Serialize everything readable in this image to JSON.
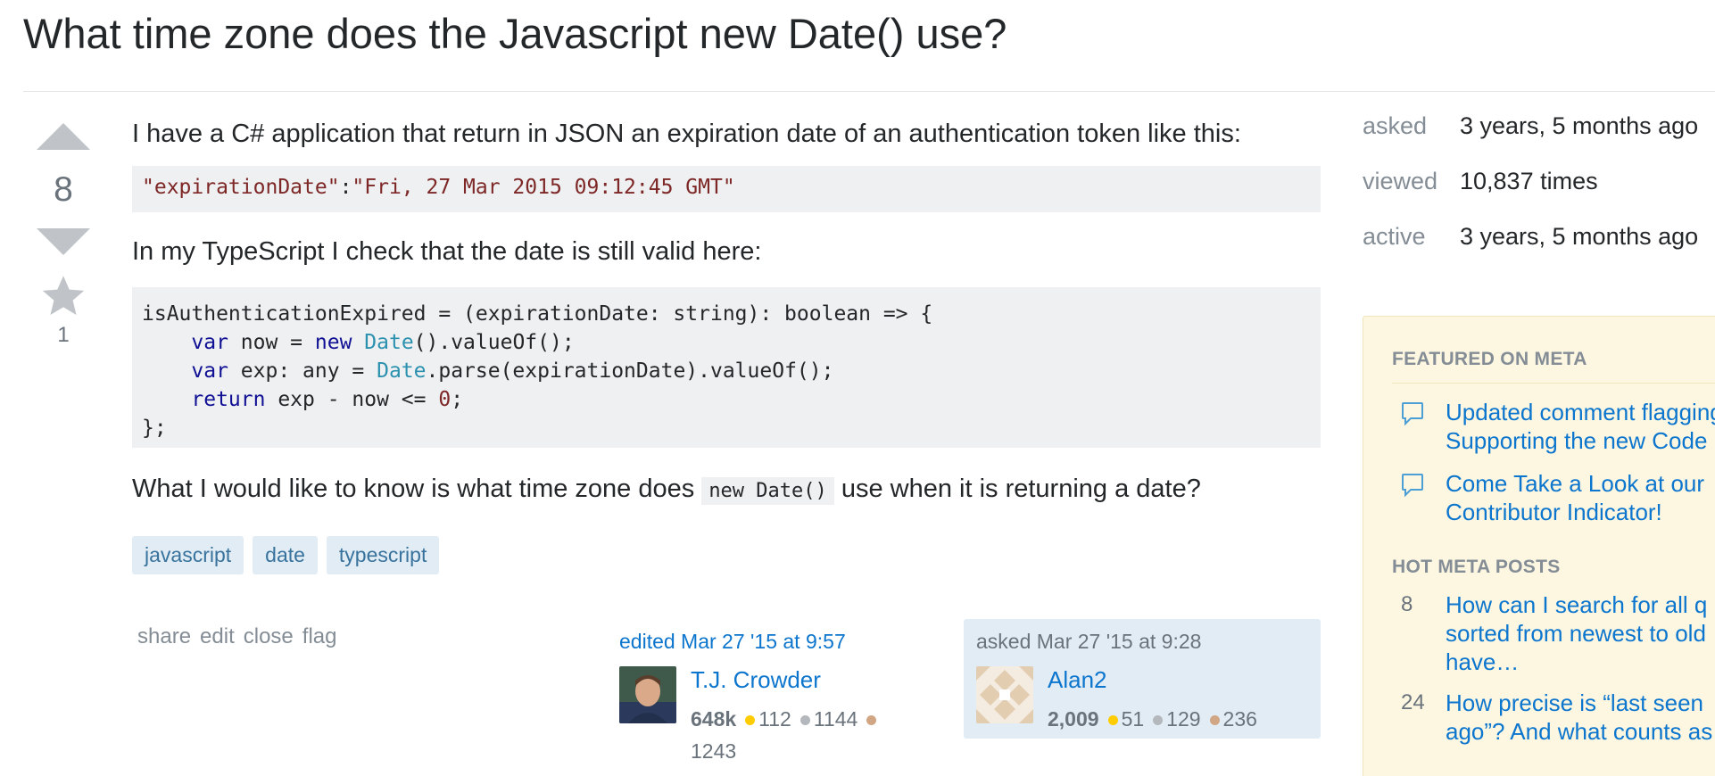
{
  "question": {
    "title": "What time zone does the Javascript new Date() use?",
    "votes": "8",
    "favorites": "1",
    "body": {
      "p1": "I have a C# application that return in JSON an expiration date of an authentication token like this:",
      "code1": {
        "key": "\"expirationDate\"",
        "colon": ":",
        "value": "\"Fri, 27 Mar 2015 09:12:45 GMT\""
      },
      "p2": "In my TypeScript I check that the date is still valid here:",
      "code2": {
        "line1": "isAuthenticationExpired = (expirationDate: string): boolean => {",
        "line2_indent": "    ",
        "var": "var",
        "now_assign": " now = ",
        "new": "new",
        "space": " ",
        "Date": "Date",
        "valueof1": "().valueOf();",
        "exp_decl": " exp: any = ",
        "parse": ".parse(expirationDate).valueOf();",
        "return": "return",
        "ret_expr": " exp - now <= ",
        "zero": "0",
        "semi": ";",
        "line5": "};"
      },
      "p3_before": "What I would like to know is what time zone does ",
      "p3_code": "new Date()",
      "p3_after": " use when it is returning a date?"
    },
    "tags": [
      "javascript",
      "date",
      "typescript"
    ],
    "menu": {
      "share": "share",
      "edit": "edit",
      "close": "close",
      "flag": "flag"
    },
    "editor": {
      "action": "edited Mar 27 '15 at 9:57",
      "name": "T.J. Crowder",
      "rep": "648k",
      "gold": "112",
      "silver": "1144",
      "bronze": "1243"
    },
    "owner": {
      "action": "asked Mar 27 '15 at 9:28",
      "name": "Alan2",
      "rep": "2,009",
      "gold": "51",
      "silver": "129",
      "bronze": "236"
    }
  },
  "sidebar": {
    "stats": [
      {
        "label": "asked",
        "value": "3 years, 5 months ago"
      },
      {
        "label": "viewed",
        "value": "10,837 times"
      },
      {
        "label": "active",
        "value": "3 years, 5 months ago"
      }
    ],
    "featured_header": "FEATURED ON META",
    "featured": [
      {
        "line1": "Updated comment flagging",
        "line2": "Supporting the new Code"
      },
      {
        "line1": "Come Take a Look at our",
        "line2": "Contributor Indicator!"
      }
    ],
    "hot_header": "HOT META POSTS",
    "hot": [
      {
        "count": "8",
        "line1": "How can I search for all q",
        "line2": "sorted from newest to old",
        "line3": "have…"
      },
      {
        "count": "24",
        "line1": "How precise is “last seen",
        "line2": "ago”? And what counts as",
        "line3": ""
      }
    ]
  },
  "colors": {
    "link": "#0c75cd",
    "tag_bg": "#e1ecf4",
    "tag_text": "#39739d",
    "meta_bg": "#fdf7e2",
    "code_bg": "#eff0f1",
    "gold": "#ffcc01",
    "silver": "#b4b8bc",
    "bronze": "#d1a684"
  }
}
